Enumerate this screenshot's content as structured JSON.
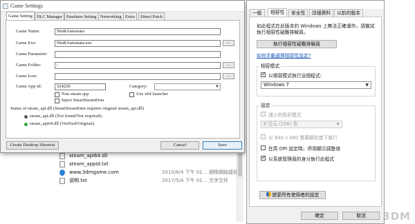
{
  "explorer": {
    "files": [
      {
        "name": "steam_api64.dll",
        "date": "",
        "type": "",
        "icon": "file-icon"
      },
      {
        "name": "steam_appid.txt",
        "date": "",
        "type": "",
        "icon": "file-icon"
      },
      {
        "name": "www.3dmgame.com",
        "date": "2010/8/4 下午 01...",
        "type": "網際網路捷徑",
        "icon": "web-shortcut-icon"
      },
      {
        "name": "说明.txt",
        "date": "2017/5/4 下午 01...",
        "type": "文字文件",
        "icon": "file-icon"
      }
    ]
  },
  "game_settings": {
    "title": "Game Settings",
    "tabs": [
      "Game Setting",
      "DLC Manager",
      "Emulator Setting",
      "Networking",
      "Extra",
      "Direct Patch"
    ],
    "active_tab": 0,
    "fields": {
      "name_label": "Game Name:",
      "name_value": "NieRAutomata",
      "exe_label": "Game Exe:",
      "exe_value": "NieRAutomata.exe",
      "params_label": "Game Parameter:",
      "params_value": "",
      "folder_label": "Game Folder:",
      "folder_value": "\\",
      "icon_label": "Game Icon:",
      "icon_value": "",
      "appid_label": "Game App Id:",
      "appid_value": "524220",
      "category_label": "Category:",
      "category_value": ""
    },
    "browse_label": "...",
    "checkboxes": {
      "non_steam": "Non steam app",
      "inject": "Inject SmartSteamEmu",
      "x64": "Use x64 launcher"
    },
    "status": {
      "heading": "Status of steam_api.dll (SmartSteamEmu requires original steam_api.dll)",
      "line1": "steam_api.dll (Not found/Not required).",
      "line2": "steam_api64.dll (Verified/Original)."
    },
    "colors": {
      "status_grey": "#555555",
      "status_green": "#2fa83a"
    },
    "buttons": {
      "shortcut": "Create Desktop Shortcut",
      "cancel": "Cancel",
      "save": "Save"
    }
  },
  "compat": {
    "tabs": [
      "一般",
      "相容性",
      "安全性",
      "詳細資料",
      "以前的版本"
    ],
    "active_tab": 1,
    "intro": "如此程式在此版本的 Windows 上無法正確運作，請嘗試執行相容性疑難排解員。",
    "troubleshoot_button": "執行相容性疑難排解員",
    "manual_link": "如何手動選擇相容性設定?",
    "mode_group": "相容模式",
    "mode_checkbox": "以相容模式執行這個程式:",
    "mode_select": "Windows 7",
    "settings_group": "設定",
    "settings": [
      {
        "label": "減少的色彩模式",
        "checked": false,
        "disabled": true
      },
      {
        "label": "以 640 x 480 螢幕解析度下執行",
        "checked": false,
        "disabled": true
      },
      {
        "label": "在高 DPI 設定時，停用顯示調整值",
        "checked": false,
        "disabled": false
      },
      {
        "label": "以系統管理員的身分執行此程式",
        "checked": true,
        "disabled": false
      }
    ],
    "color_select": "8 位元 (256) 色",
    "all_users_button": "變更所有使用者的設定",
    "ok_button": "確定",
    "cancel_button": "取消"
  },
  "watermark": "3DM"
}
